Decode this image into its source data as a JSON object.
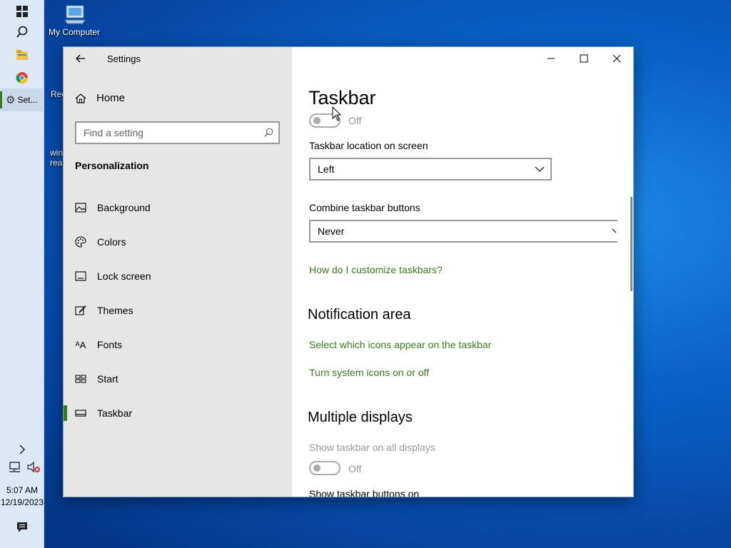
{
  "desktop": {
    "my_computer": "My Computer",
    "partial_label_1": "Rec",
    "partial_label_2a": "win",
    "partial_label_2b": "reali"
  },
  "taskbar": {
    "active_app_label": "Set...",
    "time": "5:07 AM",
    "date": "12/19/2023"
  },
  "window": {
    "title": "Settings",
    "sidebar": {
      "home_label": "Home",
      "search_placeholder": "Find a setting",
      "section_title": "Personalization",
      "items": [
        {
          "label": "Background",
          "icon": "picture-icon"
        },
        {
          "label": "Colors",
          "icon": "palette-icon"
        },
        {
          "label": "Lock screen",
          "icon": "lock-screen-icon"
        },
        {
          "label": "Themes",
          "icon": "brush-icon"
        },
        {
          "label": "Fonts",
          "icon": "font-icon"
        },
        {
          "label": "Start",
          "icon": "start-tiles-icon"
        },
        {
          "label": "Taskbar",
          "icon": "taskbar-icon",
          "selected": true
        }
      ]
    },
    "content": {
      "page_title": "Taskbar",
      "top_toggle_state": "Off",
      "location_label": "Taskbar location on screen",
      "location_value": "Left",
      "combine_label": "Combine taskbar buttons",
      "combine_value": "Never",
      "customize_link": "How do I customize taskbars?",
      "notification_heading": "Notification area",
      "notif_link_1": "Select which icons appear on the taskbar",
      "notif_link_2": "Turn system icons on or off",
      "multi_heading": "Multiple displays",
      "show_all_label": "Show taskbar on all displays",
      "show_all_state": "Off",
      "show_buttons_label": "Show taskbar buttons on"
    }
  },
  "colors": {
    "accent": "#3a7a1c",
    "sidebar_bg": "#e6e6e6",
    "taskbar_bg": "#dce8f5"
  }
}
